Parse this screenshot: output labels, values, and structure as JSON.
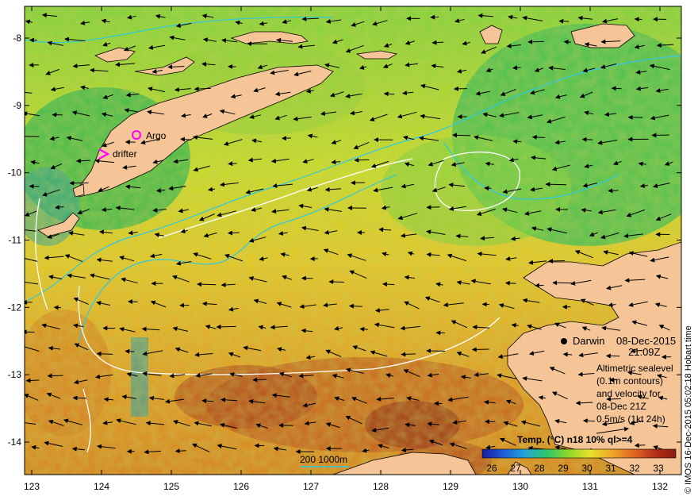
{
  "map": {
    "lon_ticks": [
      "123",
      "124",
      "125",
      "126",
      "127",
      "128",
      "129",
      "130",
      "131",
      "132"
    ],
    "lat_ticks": [
      "-8",
      "-9",
      "-10",
      "-11",
      "-12",
      "-13",
      "-14"
    ],
    "colors": {
      "land": "#f5c598",
      "contour": "#2ec8e0",
      "contour_white": "#ffffff",
      "argo": "#ff00ff",
      "drifter": "#ff00ff"
    }
  },
  "markers": {
    "argo_label": "Argo",
    "drifter_label": "drifter"
  },
  "station": {
    "name": "Darwin",
    "date": "08-Dec-2015",
    "time": "21:09Z"
  },
  "annotation": {
    "lines": [
      "Altimetric sealevel",
      "(0.1m contours)",
      "and velocity for",
      "08-Dec 21Z",
      "0.5m/s (1kt 24h)"
    ]
  },
  "colorbar": {
    "title": "Temp. (°C) n18 10% ql>=4",
    "ticks": [
      "26",
      "27",
      "28",
      "29",
      "30",
      "31",
      "32",
      "33"
    ],
    "colors": [
      "#1a1aa0",
      "#1e5cd6",
      "#22a6d8",
      "#2ec56a",
      "#8fd82c",
      "#e6e22a",
      "#f0a828",
      "#e06a20",
      "#b83018",
      "#8a1a10"
    ]
  },
  "scale": {
    "label": "200  1000m"
  },
  "credit": "© IMOS 16-Dec-2015 05:02:18 Hobart time"
}
